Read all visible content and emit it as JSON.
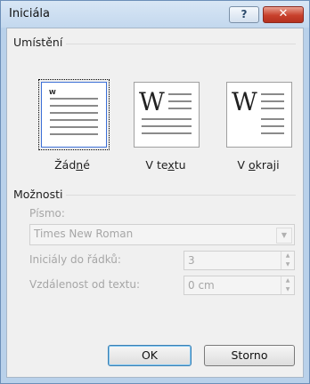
{
  "window": {
    "title": "Iniciála",
    "help_label": "?",
    "close_label": "✕"
  },
  "placement": {
    "group_label": "Umístění",
    "options": [
      {
        "label_pre": "Žád",
        "label_ul": "n",
        "label_post": "é",
        "selected": true
      },
      {
        "label_pre": "V te",
        "label_ul": "x",
        "label_post": "tu",
        "selected": false
      },
      {
        "label_pre": "V ",
        "label_ul": "o",
        "label_post": "kraji",
        "selected": false
      }
    ],
    "preview_letter": "W"
  },
  "options": {
    "group_label": "Možnosti",
    "font_label": "Písmo:",
    "font_value": "Times New Roman",
    "lines_label": "Iniciály do řádků:",
    "lines_value": "3",
    "distance_label": "Vzdálenost od textu:",
    "distance_value": "0 cm"
  },
  "buttons": {
    "ok": "OK",
    "cancel": "Storno"
  },
  "icons": {
    "help": "help-icon",
    "close": "close-icon",
    "spin_up": "chevron-up-icon",
    "spin_down": "chevron-down-icon",
    "dropdown": "chevron-down-icon"
  },
  "colors": {
    "title_bg": "#c3d8ee",
    "close_bg": "#c8402c",
    "client_bg": "#f0f0f0",
    "selected_border": "#3c6fd6"
  }
}
